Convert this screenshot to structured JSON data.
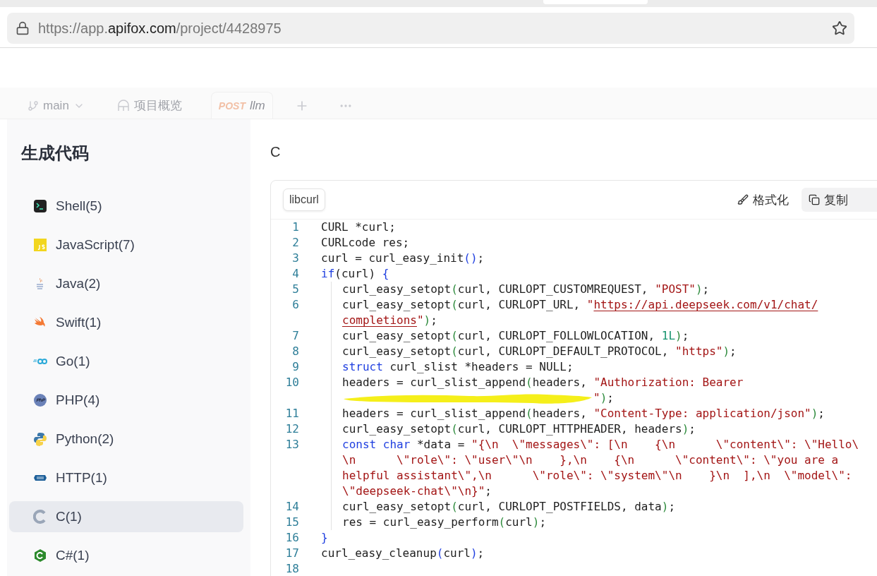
{
  "browser": {
    "url": {
      "before": "https://app.",
      "domain": "apifox.com",
      "after": "/project/4428975"
    }
  },
  "workspace": {
    "branch": {
      "label": "main"
    },
    "tabs": [
      {
        "kind": "overview",
        "label": "项目概览",
        "selected": false
      },
      {
        "kind": "request",
        "method": "POST",
        "label": "llm",
        "selected": true
      }
    ]
  },
  "dialog": {
    "title": "生成代码",
    "languages": [
      {
        "kind": "shell",
        "label": "Shell(5)",
        "selected": false
      },
      {
        "kind": "js",
        "label": "JavaScript(7)",
        "selected": false
      },
      {
        "kind": "java",
        "label": "Java(2)",
        "selected": false
      },
      {
        "kind": "swift",
        "label": "Swift(1)",
        "selected": false
      },
      {
        "kind": "go",
        "label": "Go(1)",
        "selected": false
      },
      {
        "kind": "php",
        "label": "PHP(4)",
        "selected": false
      },
      {
        "kind": "python",
        "label": "Python(2)",
        "selected": false
      },
      {
        "kind": "http",
        "label": "HTTP(1)",
        "selected": false
      },
      {
        "kind": "c",
        "label": "C(1)",
        "selected": true
      },
      {
        "kind": "csharp",
        "label": "C#(1)",
        "selected": false
      }
    ],
    "heading": "C",
    "variant_tab": "libcurl",
    "format_button": "格式化",
    "copy_button": "复制",
    "code": [
      {
        "number": "1",
        "indent": false,
        "rows": [
          {
            "segs": [
              {
                "kind": "plain",
                "text": "CURL *curl;"
              }
            ]
          }
        ]
      },
      {
        "number": "2",
        "indent": false,
        "rows": [
          {
            "segs": [
              {
                "kind": "plain",
                "text": "CURLcode res;"
              }
            ]
          }
        ]
      },
      {
        "number": "3",
        "indent": false,
        "rows": [
          {
            "segs": [
              {
                "kind": "plain",
                "text": "curl = curl_easy_init"
              },
              {
                "kind": "bracket1",
                "text": "()"
              },
              {
                "kind": "plain",
                "text": ";"
              }
            ]
          }
        ]
      },
      {
        "number": "4",
        "indent": false,
        "rows": [
          {
            "segs": [
              {
                "kind": "keyword",
                "text": "if"
              },
              {
                "kind": "plain",
                "text": "(curl)"
              },
              {
                "kind": "bracket1",
                "text": " {"
              }
            ]
          }
        ]
      },
      {
        "number": "5",
        "indent": true,
        "rows": [
          {
            "segs": [
              {
                "kind": "plain",
                "text": "curl_easy_setopt"
              },
              {
                "kind": "bracket2",
                "text": "("
              },
              {
                "kind": "plain",
                "text": "curl, CURLOPT_CUSTOMREQUEST, "
              },
              {
                "kind": "string",
                "text": "\"POST\""
              },
              {
                "kind": "bracket2",
                "text": ")"
              },
              {
                "kind": "plain",
                "text": ";"
              }
            ]
          }
        ]
      },
      {
        "number": "6",
        "indent": true,
        "rows": [
          {
            "segs": [
              {
                "kind": "plain",
                "text": "curl_easy_setopt"
              },
              {
                "kind": "bracket2",
                "text": "("
              },
              {
                "kind": "plain",
                "text": "curl, CURLOPT_URL, "
              },
              {
                "kind": "string",
                "text": "\""
              },
              {
                "kind": "url",
                "text": "https://api.deepseek.com/v1/chat/"
              }
            ]
          },
          {
            "segs": [
              {
                "kind": "url",
                "text": "completions"
              },
              {
                "kind": "string",
                "text": "\""
              },
              {
                "kind": "bracket2",
                "text": ")"
              },
              {
                "kind": "plain",
                "text": ";"
              }
            ]
          }
        ]
      },
      {
        "number": "7",
        "indent": true,
        "rows": [
          {
            "segs": [
              {
                "kind": "plain",
                "text": "curl_easy_setopt"
              },
              {
                "kind": "bracket2",
                "text": "("
              },
              {
                "kind": "plain",
                "text": "curl, CURLOPT_FOLLOWLOCATION, "
              },
              {
                "kind": "number",
                "text": "1L"
              },
              {
                "kind": "bracket2",
                "text": ")"
              },
              {
                "kind": "plain",
                "text": ";"
              }
            ]
          }
        ]
      },
      {
        "number": "8",
        "indent": true,
        "rows": [
          {
            "segs": [
              {
                "kind": "plain",
                "text": "curl_easy_setopt"
              },
              {
                "kind": "bracket2",
                "text": "("
              },
              {
                "kind": "plain",
                "text": "curl, CURLOPT_DEFAULT_PROTOCOL, "
              },
              {
                "kind": "string",
                "text": "\"https\""
              },
              {
                "kind": "bracket2",
                "text": ")"
              },
              {
                "kind": "plain",
                "text": ";"
              }
            ]
          }
        ]
      },
      {
        "number": "9",
        "indent": true,
        "rows": [
          {
            "segs": [
              {
                "kind": "keyword",
                "text": "struct"
              },
              {
                "kind": "plain",
                "text": " curl_slist *headers = NULL;"
              }
            ]
          }
        ]
      },
      {
        "number": "10",
        "indent": true,
        "rows": [
          {
            "segs": [
              {
                "kind": "plain",
                "text": "headers = curl_slist_append"
              },
              {
                "kind": "bracket2",
                "text": "("
              },
              {
                "kind": "plain",
                "text": "headers, "
              },
              {
                "kind": "string",
                "text": "\"Authorization: Bearer"
              }
            ]
          },
          {
            "redacted": true,
            "segs": [
              {
                "kind": "string",
                "text": "\""
              },
              {
                "kind": "bracket2",
                "text": ")"
              },
              {
                "kind": "plain",
                "text": ";"
              }
            ]
          }
        ]
      },
      {
        "number": "11",
        "indent": true,
        "rows": [
          {
            "segs": [
              {
                "kind": "plain",
                "text": "headers = curl_slist_append"
              },
              {
                "kind": "bracket2",
                "text": "("
              },
              {
                "kind": "plain",
                "text": "headers, "
              },
              {
                "kind": "string",
                "text": "\"Content-Type: application/json\""
              },
              {
                "kind": "bracket2",
                "text": ")"
              },
              {
                "kind": "plain",
                "text": ";"
              }
            ]
          }
        ]
      },
      {
        "number": "12",
        "indent": true,
        "rows": [
          {
            "segs": [
              {
                "kind": "plain",
                "text": "curl_easy_setopt"
              },
              {
                "kind": "bracket2",
                "text": "("
              },
              {
                "kind": "plain",
                "text": "curl, CURLOPT_HTTPHEADER, headers"
              },
              {
                "kind": "bracket2",
                "text": ")"
              },
              {
                "kind": "plain",
                "text": ";"
              }
            ]
          }
        ]
      },
      {
        "number": "13",
        "indent": true,
        "rows": [
          {
            "segs": [
              {
                "kind": "keyword",
                "text": "const char"
              },
              {
                "kind": "plain",
                "text": " *data = "
              },
              {
                "kind": "string",
                "text": "\"{\\n  \\\"messages\\\": [\\n    {\\n      \\\"content\\\": \\\"Hello\\"
              }
            ]
          },
          {
            "segs": [
              {
                "kind": "string",
                "text": "\\n      \\\"role\\\": \\\"user\\\"\\n    },\\n    {\\n      \\\"content\\\": \\\"you are a"
              }
            ]
          },
          {
            "segs": [
              {
                "kind": "string",
                "text": "helpful assistant\\\",\\n      \\\"role\\\": \\\"system\\\"\\n    }\\n  ],\\n  \\\"model\\\":"
              }
            ]
          },
          {
            "segs": [
              {
                "kind": "string",
                "text": "\\\"deepseek-chat\\\"\\n}\""
              },
              {
                "kind": "plain",
                "text": ";"
              }
            ]
          }
        ]
      },
      {
        "number": "14",
        "indent": true,
        "rows": [
          {
            "segs": [
              {
                "kind": "plain",
                "text": "curl_easy_setopt"
              },
              {
                "kind": "bracket2",
                "text": "("
              },
              {
                "kind": "plain",
                "text": "curl, CURLOPT_POSTFIELDS, data"
              },
              {
                "kind": "bracket2",
                "text": ")"
              },
              {
                "kind": "plain",
                "text": ";"
              }
            ]
          }
        ]
      },
      {
        "number": "15",
        "indent": true,
        "rows": [
          {
            "segs": [
              {
                "kind": "plain",
                "text": "res = curl_easy_perform"
              },
              {
                "kind": "bracket2",
                "text": "("
              },
              {
                "kind": "plain",
                "text": "curl"
              },
              {
                "kind": "bracket2",
                "text": ")"
              },
              {
                "kind": "plain",
                "text": ";"
              }
            ]
          }
        ]
      },
      {
        "number": "16",
        "indent": false,
        "rows": [
          {
            "segs": [
              {
                "kind": "bracket1",
                "text": "}"
              }
            ]
          }
        ]
      },
      {
        "number": "17",
        "indent": false,
        "rows": [
          {
            "segs": [
              {
                "kind": "plain",
                "text": "curl_easy_cleanup"
              },
              {
                "kind": "bracket1",
                "text": "("
              },
              {
                "kind": "plain",
                "text": "curl"
              },
              {
                "kind": "bracket1",
                "text": ")"
              },
              {
                "kind": "plain",
                "text": ";"
              }
            ]
          }
        ]
      },
      {
        "number": "18",
        "indent": false
      }
    ]
  }
}
